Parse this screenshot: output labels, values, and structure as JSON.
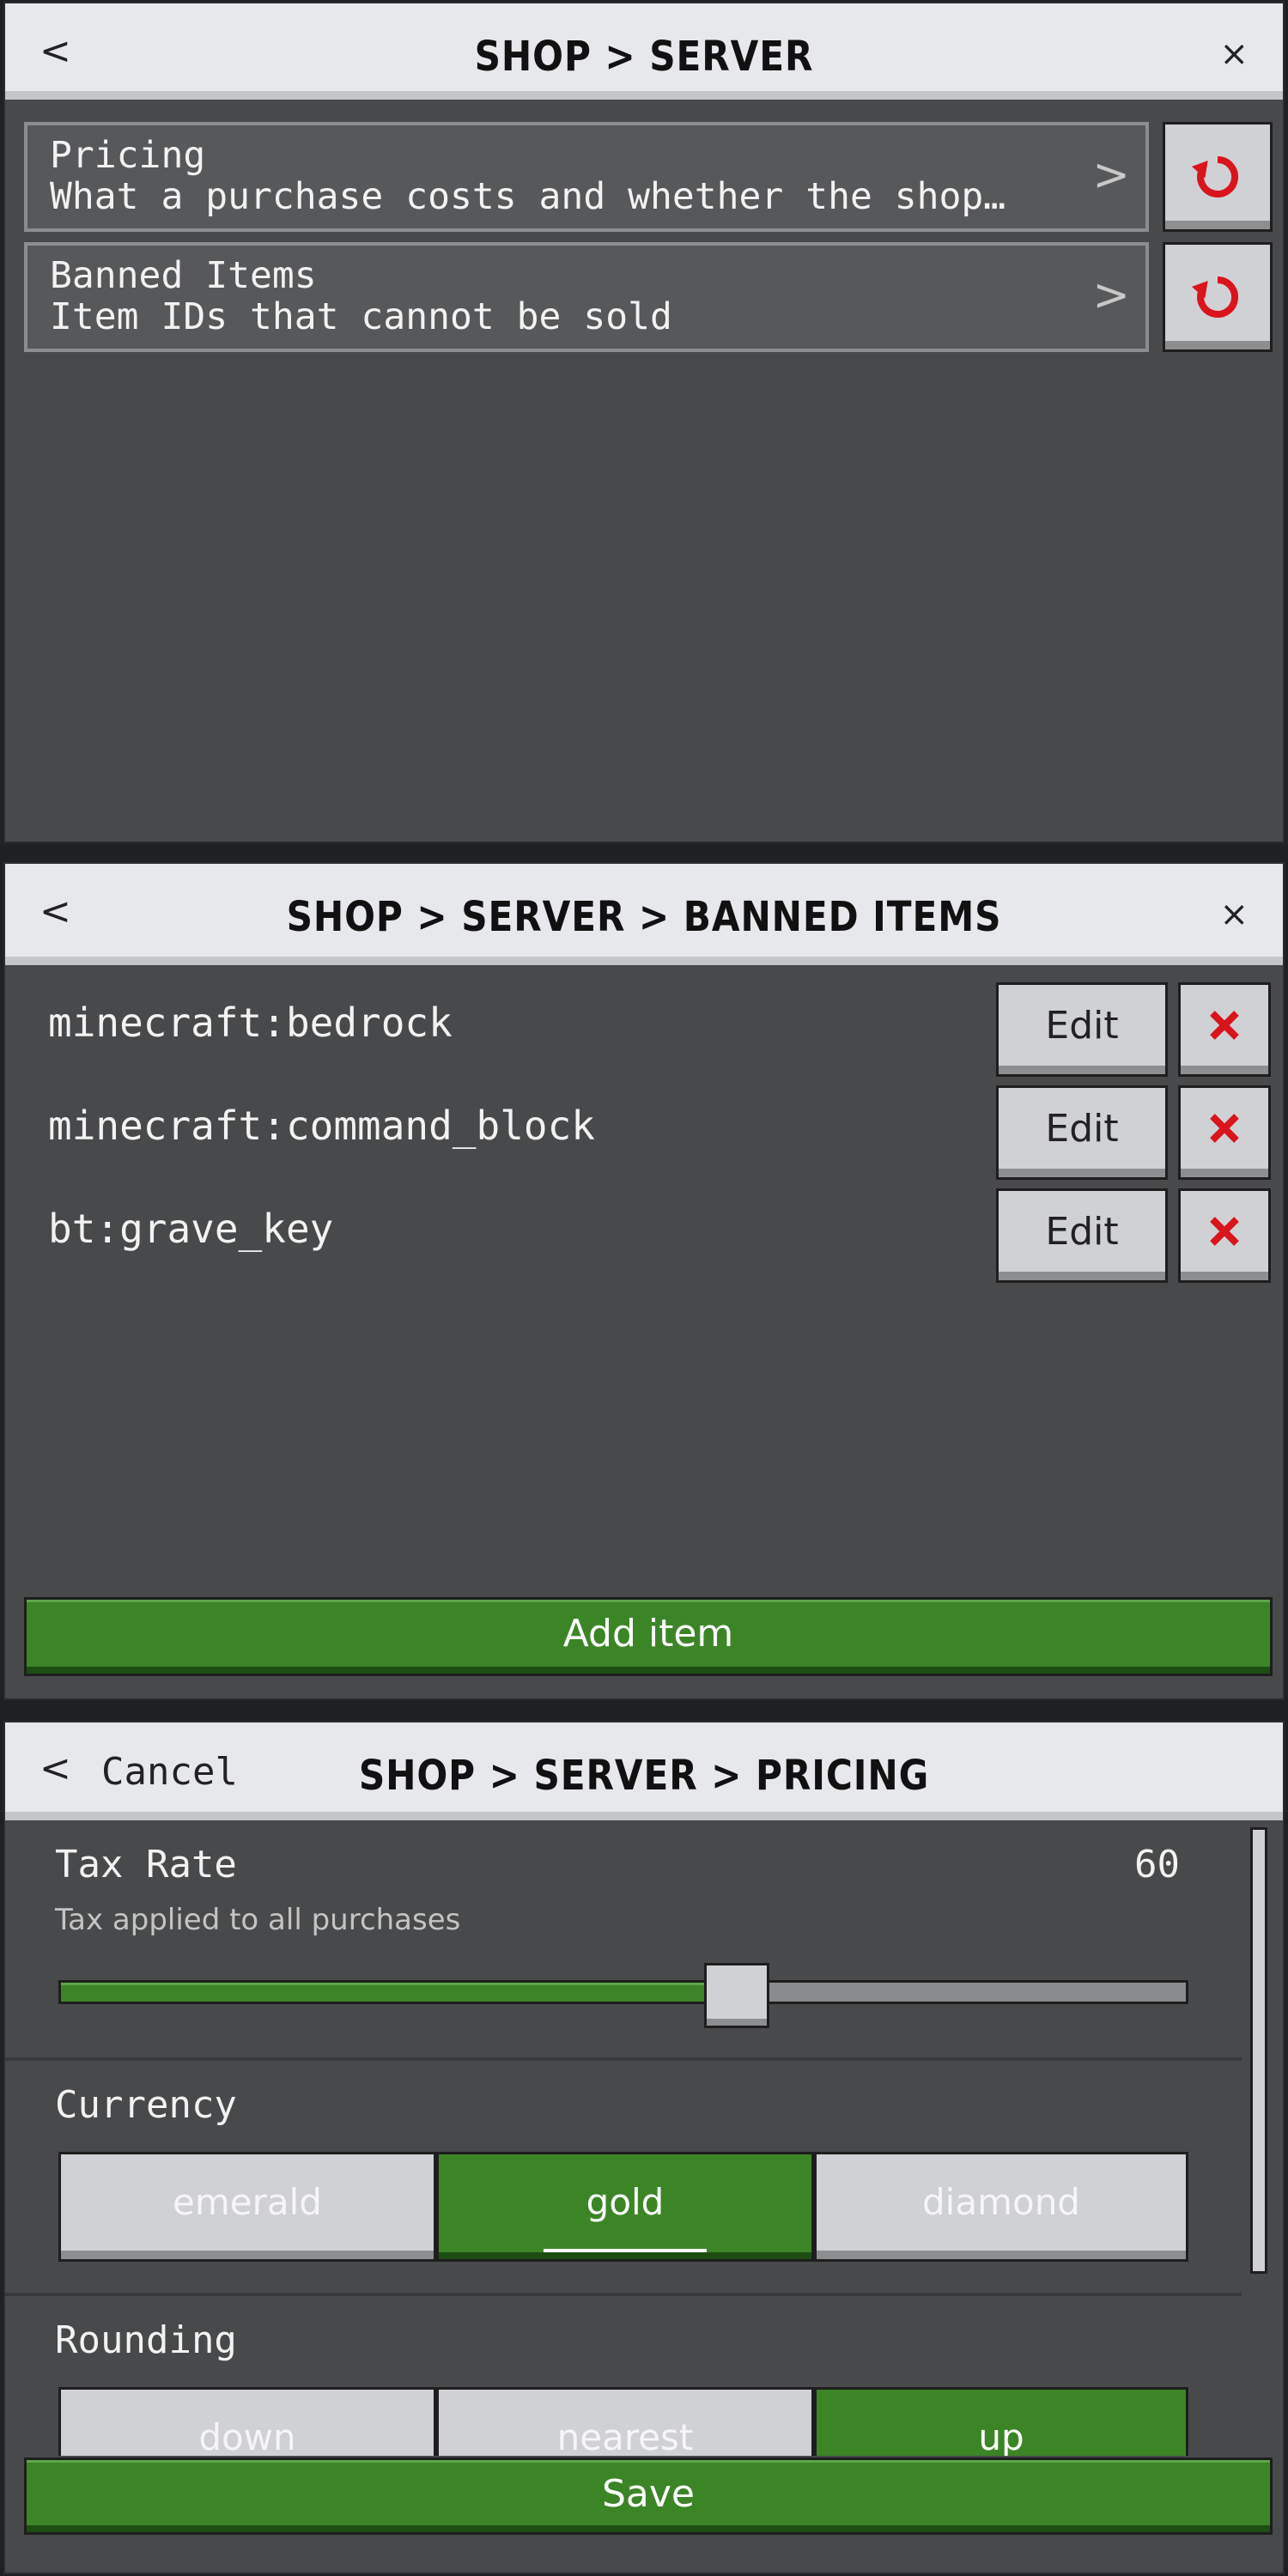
{
  "server_panel": {
    "breadcrumb": "SHOP > SERVER",
    "back_glyph": "<",
    "close_glyph": "×",
    "categories": [
      {
        "title": "Pricing",
        "subtitle": "What a purchase costs and whether the shop…"
      },
      {
        "title": "Banned Items",
        "subtitle": "Item IDs that cannot be sold"
      }
    ]
  },
  "banned_panel": {
    "breadcrumb": "SHOP > SERVER > BANNED ITEMS",
    "items": [
      {
        "id": "minecraft:bedrock",
        "edit_label": "Edit"
      },
      {
        "id": "minecraft:command_block",
        "edit_label": "Edit"
      },
      {
        "id": "bt:grave_key",
        "edit_label": "Edit"
      }
    ],
    "add_label": "Add item"
  },
  "pricing_panel": {
    "breadcrumb": "SHOP > SERVER > PRICING",
    "cancel_label": "Cancel",
    "tax": {
      "label": "Tax Rate",
      "value": "60",
      "description": "Tax applied to all purchases",
      "fraction": 0.6
    },
    "currency": {
      "label": "Currency",
      "options": [
        "emerald",
        "gold",
        "diamond"
      ],
      "selected": "gold"
    },
    "rounding": {
      "label": "Rounding",
      "options": [
        "down",
        "nearest",
        "up"
      ],
      "selected": "up"
    },
    "save_label": "Save"
  },
  "colors": {
    "accent_green": "#3c8527",
    "reset_red": "#d9141c",
    "panel_bg": "#48494a"
  },
  "icons": [
    "back-chevron-icon",
    "close-icon",
    "chevron-right-icon",
    "reset-icon",
    "delete-x-icon"
  ]
}
